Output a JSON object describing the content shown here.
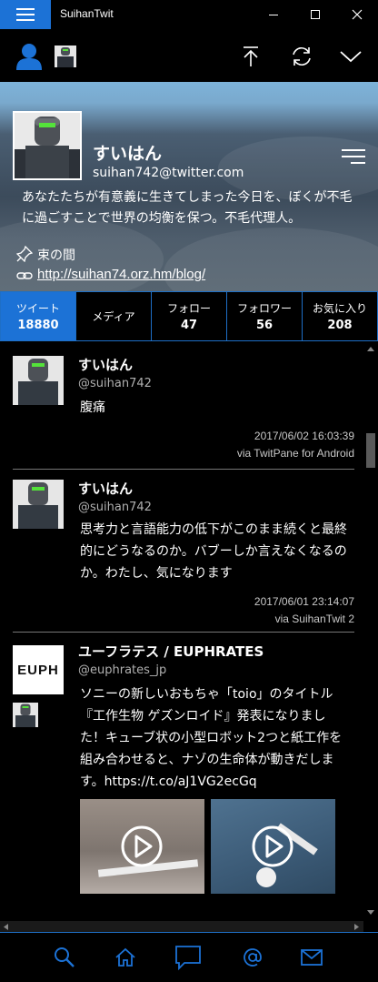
{
  "window": {
    "title": "SuihanTwit"
  },
  "profile": {
    "name": "すいはん",
    "handle": "suihan742@twitter.com",
    "bio": "あなたたちが有意義に生きてしまった今日を、ぼくが不毛に過ごすことで世界の均衡を保つ。不毛代理人。",
    "location": "束の間",
    "url": "http://suihan74.orz.hm/blog/"
  },
  "tabs": [
    {
      "label": "ツイート",
      "count": "18880",
      "active": true
    },
    {
      "label": "メディア",
      "count": ""
    },
    {
      "label": "フォロー",
      "count": "47"
    },
    {
      "label": "フォロワー",
      "count": "56"
    },
    {
      "label": "お気に入り",
      "count": "208"
    }
  ],
  "tweets": [
    {
      "name": "すいはん",
      "handle": "@suihan742",
      "text": "腹痛",
      "timestamp": "2017/06/02 16:03:39",
      "via": "via TwitPane for Android"
    },
    {
      "name": "すいはん",
      "handle": "@suihan742",
      "text": "思考力と言語能力の低下がこのまま続くと最終的にどうなるのか。バブーしか言えなくなるのか。わたし、気になります",
      "timestamp": "2017/06/01 23:14:07",
      "via": "via SuihanTwit 2"
    },
    {
      "name": "ユーフラテス / EUPHRATES",
      "handle": "@euphrates_jp",
      "logo_text": "EUPH",
      "text": "ソニーの新しいおもちゃ「toio」のタイトル『工作生物 ゲズンロイド』発表になりました！キューブ状の小型ロボット2つと紙工作を組み合わせると、ナゾの生命体が動きだします。https://t.co/aJ1VG2ecGq"
    }
  ],
  "icons": {
    "menu": "hamburger-icon",
    "minimize": "minimize-icon",
    "maximize": "maximize-icon",
    "close": "close-icon",
    "account": "person-icon",
    "scroll_top": "arrow-up-to-top-icon",
    "refresh": "refresh-icon",
    "expand": "chevron-down-icon",
    "search": "search-icon",
    "home": "home-icon",
    "message": "chat-bubble-icon",
    "mention": "at-icon",
    "mail": "envelope-icon"
  },
  "colors": {
    "accent": "#1c72d6",
    "background": "#000000"
  }
}
